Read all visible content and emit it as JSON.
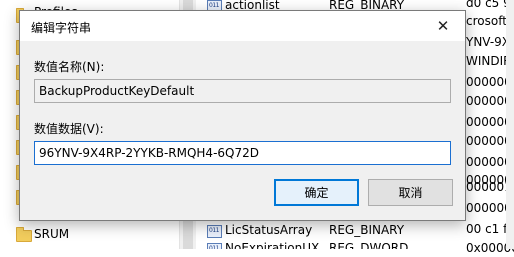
{
  "background": {
    "tree_items": [
      "Profiles",
      "SRUM"
    ],
    "values_rows": [
      {
        "name": "actionlist",
        "type": "REG_BINARY"
      },
      {
        "name": "LicStatusArray",
        "type": "REG_BINARY"
      },
      {
        "name": "NoExpirationUX",
        "type": "REG_DWORD"
      }
    ],
    "data_column": [
      "d0 c5 92 d",
      "crosoft.C",
      "YNV-9X4",
      "WINDIR%",
      "0000000",
      "0000000",
      "0000000",
      "0000000",
      "0000000",
      "0000000",
      "000001e",
      "0000000",
      "00 c1 f0 62",
      "0x0000000"
    ]
  },
  "dialog": {
    "title": "编辑字符串",
    "close_glyph": "✕",
    "name_label": "数值名称(N):",
    "name_value": "BackupProductKeyDefault",
    "data_label": "数值数据(V):",
    "data_value": "96YNV-9X4RP-2YYKB-RMQH4-6Q72D",
    "ok_label": "确定",
    "cancel_label": "取消"
  },
  "colors": {
    "accent": "#0078d7",
    "field_focus_border": "#1b6fd1",
    "folder": "#f2cd5d"
  },
  "icons": {
    "close": "close-icon",
    "folder": "folder-icon",
    "binary_value": "binary-value-icon"
  }
}
